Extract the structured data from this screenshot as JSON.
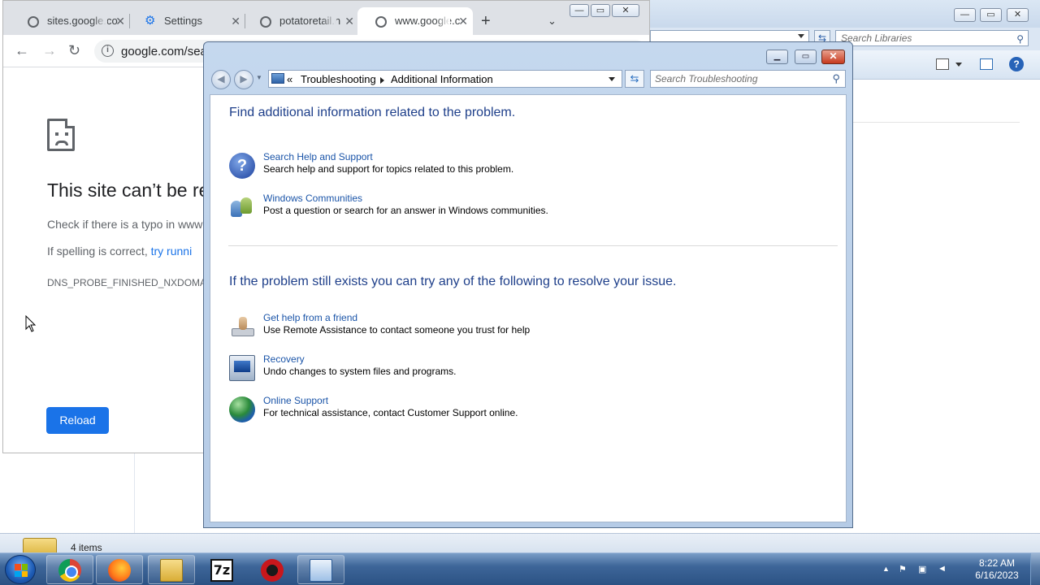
{
  "chrome": {
    "tabs": [
      {
        "title": "sites.google.co"
      },
      {
        "title": "Settings"
      },
      {
        "title": "potatoretail.n"
      },
      {
        "title": "www.google.c"
      }
    ],
    "url": "google.com/sear",
    "error": {
      "title": "This site can’t be re",
      "line1": "Check if there is a typo in www",
      "line2_prefix": "If spelling is correct, ",
      "line2_link": "try runni",
      "code": "DNS_PROBE_FINISHED_NXDOMAIN",
      "reload": "Reload"
    }
  },
  "explorer": {
    "search_placeholder": "Search Libraries",
    "status_items": "4 items"
  },
  "troubleshooting": {
    "breadcrumb": {
      "prefix": "«",
      "part1": "Troubleshooting",
      "part2": "Additional Information"
    },
    "search_placeholder": "Search Troubleshooting",
    "section1_title": "Find additional information related to the problem.",
    "section1_items": [
      {
        "link": "Search Help and Support",
        "desc": "Search help and support for topics related to this problem.",
        "icon": "help-icon"
      },
      {
        "link": "Windows Communities",
        "desc": "Post a question or search for an answer in Windows communities.",
        "icon": "communities-icon"
      }
    ],
    "section2_title": "If the problem still exists you can try any of the following to resolve your issue.",
    "section2_items": [
      {
        "link": "Get help from a friend",
        "desc": "Use Remote Assistance to contact someone you trust for help",
        "icon": "remote-assistance-icon"
      },
      {
        "link": "Recovery",
        "desc": "Undo changes to system files and programs.",
        "icon": "recovery-icon"
      },
      {
        "link": "Online Support",
        "desc": "For technical assistance, contact Customer Support online.",
        "icon": "globe-icon"
      }
    ]
  },
  "taskbar": {
    "apps": [
      "chrome",
      "firefox",
      "windows-explorer",
      "7-zip",
      "red-app",
      "control-panel"
    ],
    "time": "8:22 AM",
    "date": "6/16/2023"
  }
}
